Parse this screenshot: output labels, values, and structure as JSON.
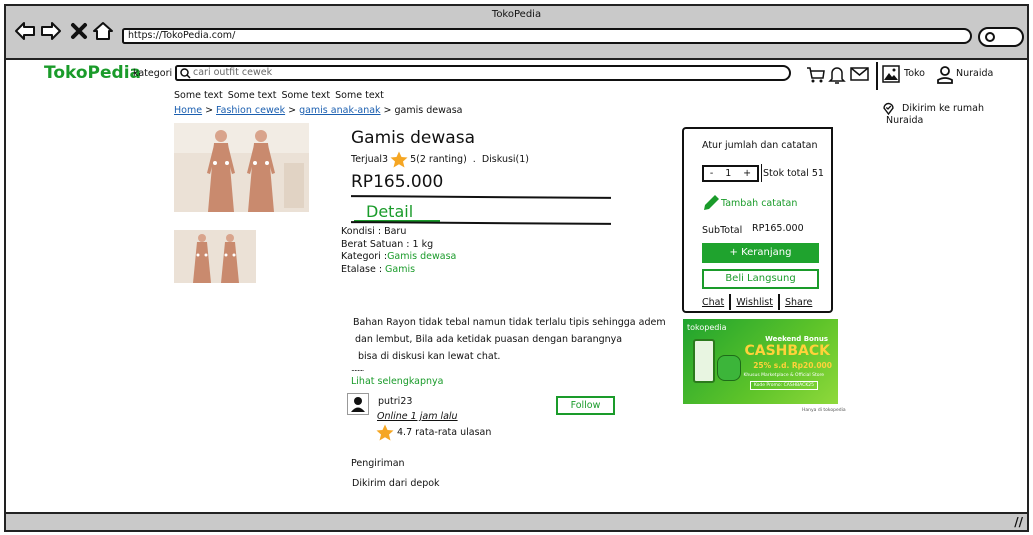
{
  "window": {
    "title": "TokoPedia",
    "url": "https://TokoPedia.com/"
  },
  "header": {
    "logo": "TokoPedia",
    "kategori": "kategori",
    "search_placeholder": "cari outfit cewek",
    "toko_label": "Toko",
    "user_name": "Nuraida"
  },
  "quick_links": [
    "Some text",
    "Some text",
    "Some text",
    "Some text"
  ],
  "breadcrumb": {
    "items": [
      "Home",
      "Fashion cewek",
      "gamis anak-anak"
    ],
    "current": "gamis dewasa",
    "separator": ">"
  },
  "shipping_to": {
    "label": "Dikirim ke rumah",
    "name": "Nuraida"
  },
  "product": {
    "title": "Gamis dewasa",
    "sold": "Terjual3",
    "rating": "5(2 ranting)",
    "dot": ".",
    "discussion": "Diskusi(1)",
    "price": "RP165.000",
    "detail_tab": "Detail",
    "specs": {
      "kondisi": "Kondisi : Baru",
      "berat": "Berat Satuan : 1 kg",
      "kategori_label": "Kategori :",
      "kategori_value": "Gamis dewasa",
      "etalase_label": "Etalase : ",
      "etalase_value": "Gamis"
    },
    "description": [
      "Bahan Rayon tidak tebal namun tidak terlalu tipis sehingga adem",
      "dan lembut, Bila ada ketidak puasan dengan barangnya",
      "bisa di diskusi kan lewat chat."
    ],
    "ellipsis": "........",
    "read_more": "Lihat selengkapnya"
  },
  "seller": {
    "name": "putri23",
    "status": "Online 1 jam lalu",
    "rating": "4.7 rata-rata ulasan",
    "follow_label": "Follow"
  },
  "shipping": {
    "heading": "Pengiriman",
    "from": "Dikirim dari depok"
  },
  "purchase_card": {
    "heading": "Atur jumlah dan catatan",
    "qty_minus": "-",
    "qty_value": "1",
    "qty_plus": "+",
    "stock": "Stok total 51",
    "add_note": "Tambah catatan",
    "subtotal_label": "SubTotal",
    "subtotal_value": "RP165.000",
    "cart_button": "+ Keranjang",
    "buy_button": "Beli Langsung",
    "links": [
      "Chat",
      "Wishlist",
      "Share"
    ]
  },
  "banner": {
    "brand": "tokopedia",
    "bonus": "Weekend Bonus",
    "cashback": "CASHBACK",
    "offer": "25% s.d. Rp20.000",
    "fine": "Khusus Marketplace & Official Store",
    "code": "Kode Promo: CASHBACK25",
    "footer": "Hanya di tokopedia"
  },
  "colors": {
    "brand_green": "#1a9b2a",
    "link_blue": "#1b5fb0",
    "chrome_gray": "#c9c9c9"
  }
}
